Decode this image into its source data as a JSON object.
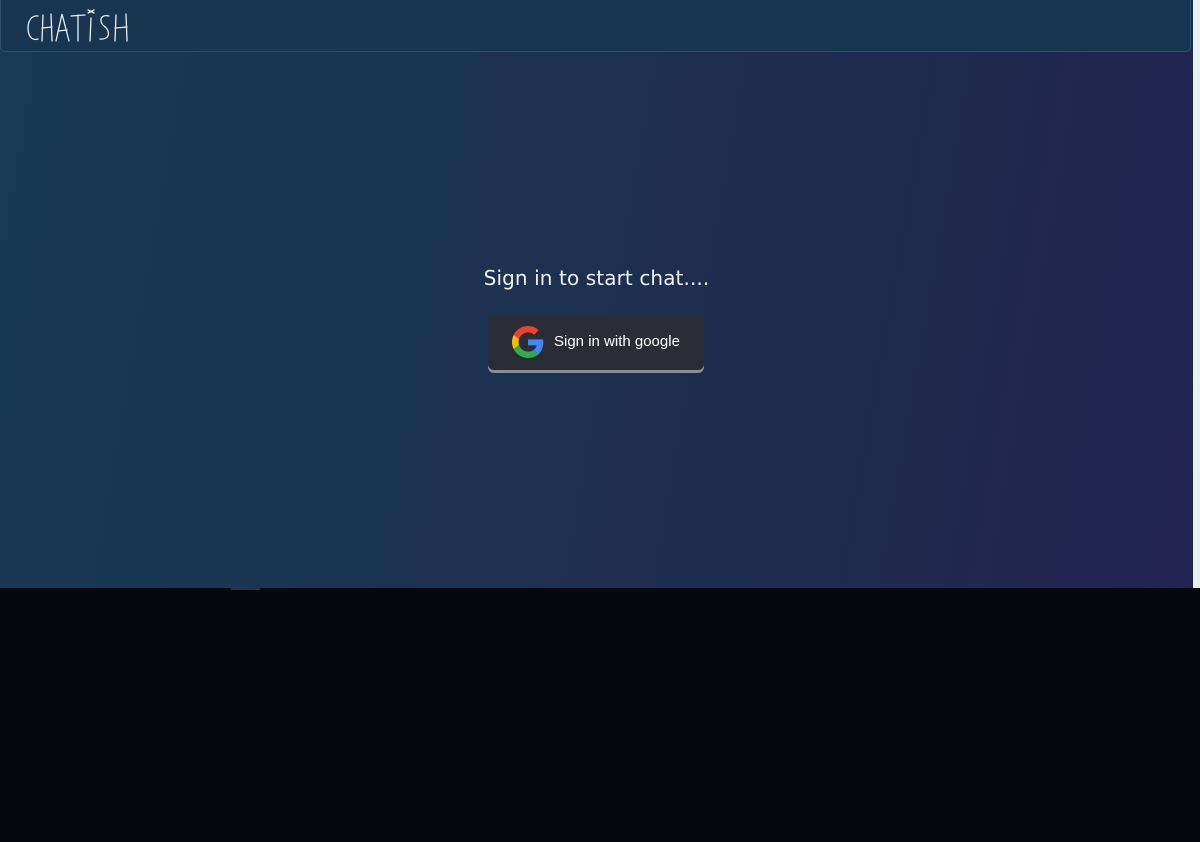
{
  "app": {
    "logo_text": "CHATISH"
  },
  "hero": {
    "headline": "Sign in to start chat....",
    "signin_button_label": "Sign in with google",
    "signin_icon": "google-g-icon"
  },
  "colors": {
    "bg_gradient_start": "#183a52",
    "bg_gradient_end": "#232350",
    "navbar_bg": "#193650",
    "button_bg": "#2a2d36",
    "text_light": "#eef2f6",
    "lower_area": "#06080e"
  }
}
